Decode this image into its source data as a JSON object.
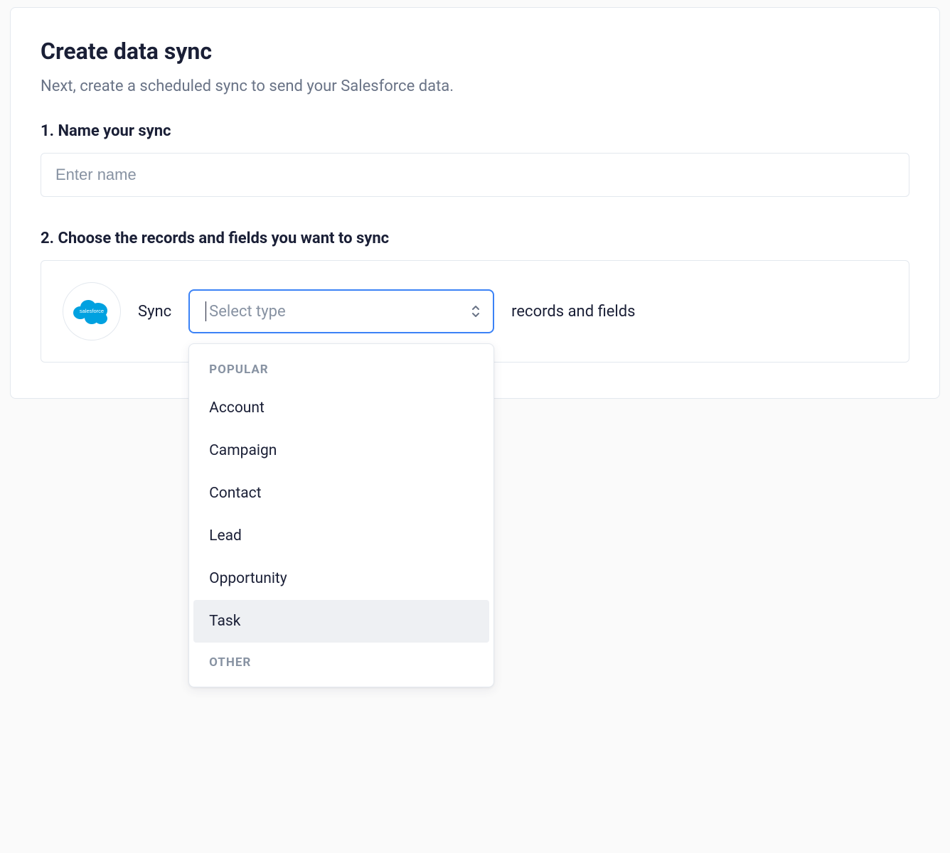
{
  "card": {
    "title": "Create data sync",
    "subtitle": "Next, create a scheduled sync to send your Salesforce data."
  },
  "step1": {
    "label": "1. Name your sync",
    "name_value": "",
    "name_placeholder": "Enter name"
  },
  "step2": {
    "label": "2. Choose the records and fields you want to sync",
    "icon_label": "salesforce",
    "sync_text": "Sync",
    "trail_text": "records and fields",
    "select_placeholder": "Select type",
    "dropdown": {
      "group1_label": "POPULAR",
      "options": [
        "Account",
        "Campaign",
        "Contact",
        "Lead",
        "Opportunity",
        "Task"
      ],
      "highlighted_index": 5,
      "group2_label": "OTHER"
    }
  },
  "colors": {
    "accent": "#3b82f6",
    "salesforce": "#00a1e0"
  }
}
